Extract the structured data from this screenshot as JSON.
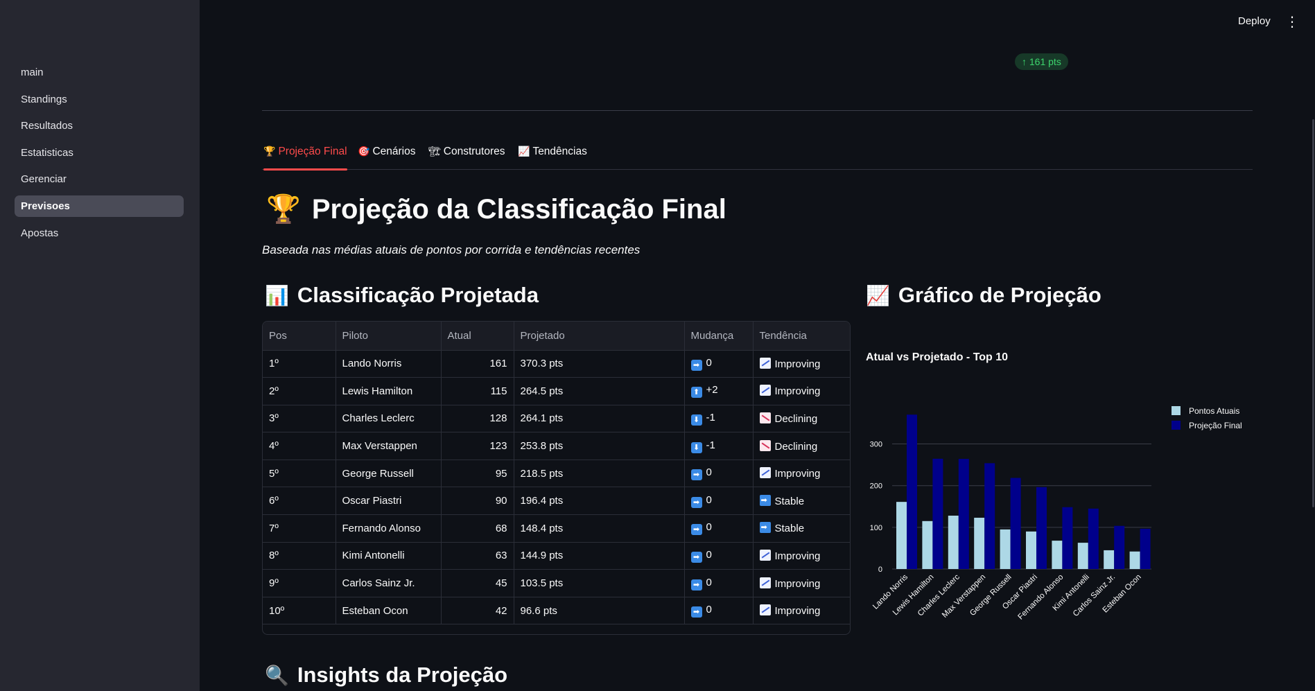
{
  "sidebar": {
    "items": [
      {
        "label": "main",
        "active": false
      },
      {
        "label": "Standings",
        "active": false
      },
      {
        "label": "Resultados",
        "active": false
      },
      {
        "label": "Estatisticas",
        "active": false
      },
      {
        "label": "Gerenciar",
        "active": false
      },
      {
        "label": "Previsoes",
        "active": true
      },
      {
        "label": "Apostas",
        "active": false
      }
    ]
  },
  "header": {
    "deploy_label": "Deploy",
    "menu_icon": "⋮"
  },
  "metric": {
    "delta": "↑ 161 pts"
  },
  "tabs": [
    {
      "icon": "🏆",
      "label": "Projeção Final",
      "active": true
    },
    {
      "icon": "🎯",
      "label": "Cenários",
      "active": false
    },
    {
      "icon": "🏗",
      "label": "Construtores",
      "active": false
    },
    {
      "icon": "📈",
      "label": "Tendências",
      "active": false
    }
  ],
  "page": {
    "title_icon": "🏆",
    "title": "Projeção da Classificação Final",
    "subtitle": "Baseada nas médias atuais de pontos por corrida e tendências recentes",
    "table_heading_icon": "📊",
    "table_heading": "Classificação Projetada",
    "chart_heading_icon": "📈",
    "chart_heading": "Gráfico de Projeção",
    "insights_heading_icon": "🔍",
    "insights_heading": "Insights da Projeção"
  },
  "table": {
    "columns": [
      "Pos",
      "Piloto",
      "Atual",
      "Projetado",
      "Mudança",
      "Tendência"
    ],
    "rows": [
      {
        "pos": "1º",
        "piloto": "Lando Norris",
        "atual": "161",
        "projetado": "370.3 pts",
        "mudanca_icon": "➡",
        "mudanca": "0",
        "tendencia_type": "up",
        "tendencia": "Improving"
      },
      {
        "pos": "2º",
        "piloto": "Lewis Hamilton",
        "atual": "115",
        "projetado": "264.5 pts",
        "mudanca_icon": "⬆",
        "mudanca": "+2",
        "tendencia_type": "up",
        "tendencia": "Improving"
      },
      {
        "pos": "3º",
        "piloto": "Charles Leclerc",
        "atual": "128",
        "projetado": "264.1 pts",
        "mudanca_icon": "⬇",
        "mudanca": "-1",
        "tendencia_type": "down",
        "tendencia": "Declining"
      },
      {
        "pos": "4º",
        "piloto": "Max Verstappen",
        "atual": "123",
        "projetado": "253.8 pts",
        "mudanca_icon": "⬇",
        "mudanca": "-1",
        "tendencia_type": "down",
        "tendencia": "Declining"
      },
      {
        "pos": "5º",
        "piloto": "George Russell",
        "atual": "95",
        "projetado": "218.5 pts",
        "mudanca_icon": "➡",
        "mudanca": "0",
        "tendencia_type": "up",
        "tendencia": "Improving"
      },
      {
        "pos": "6º",
        "piloto": "Oscar Piastri",
        "atual": "90",
        "projetado": "196.4 pts",
        "mudanca_icon": "➡",
        "mudanca": "0",
        "tendencia_type": "stable",
        "tendencia": "Stable"
      },
      {
        "pos": "7º",
        "piloto": "Fernando Alonso",
        "atual": "68",
        "projetado": "148.4 pts",
        "mudanca_icon": "➡",
        "mudanca": "0",
        "tendencia_type": "stable",
        "tendencia": "Stable"
      },
      {
        "pos": "8º",
        "piloto": "Kimi Antonelli",
        "atual": "63",
        "projetado": "144.9 pts",
        "mudanca_icon": "➡",
        "mudanca": "0",
        "tendencia_type": "up",
        "tendencia": "Improving"
      },
      {
        "pos": "9º",
        "piloto": "Carlos Sainz Jr.",
        "atual": "45",
        "projetado": "103.5 pts",
        "mudanca_icon": "➡",
        "mudanca": "0",
        "tendencia_type": "up",
        "tendencia": "Improving"
      },
      {
        "pos": "10º",
        "piloto": "Esteban Ocon",
        "atual": "42",
        "projetado": "96.6 pts",
        "mudanca_icon": "➡",
        "mudanca": "0",
        "tendencia_type": "up",
        "tendencia": "Improving"
      }
    ]
  },
  "chart_data": {
    "type": "bar",
    "title": "Atual vs Projetado - Top 10",
    "categories": [
      "Lando Norris",
      "Lewis Hamilton",
      "Charles Leclerc",
      "Max Verstappen",
      "George Russell",
      "Oscar Piastri",
      "Fernando Alonso",
      "Kimi Antonelli",
      "Carlos Sainz Jr.",
      "Esteban Ocon"
    ],
    "series": [
      {
        "name": "Pontos Atuais",
        "color": "#add8e6",
        "values": [
          161,
          115,
          128,
          123,
          95,
          90,
          68,
          63,
          45,
          42
        ]
      },
      {
        "name": "Projeção Final",
        "color": "#00008b",
        "values": [
          370.3,
          264.5,
          264.1,
          253.8,
          218.5,
          196.4,
          148.4,
          144.9,
          103.5,
          96.6
        ]
      }
    ],
    "yticks": [
      0,
      100,
      200,
      300
    ],
    "ylim": [
      0,
      389
    ],
    "legend": "right",
    "grid": true
  },
  "colors": {
    "accent": "#ff4b4b",
    "sidebar": "#262730",
    "background": "#0e1117",
    "delta_text": "#3dd56d"
  }
}
